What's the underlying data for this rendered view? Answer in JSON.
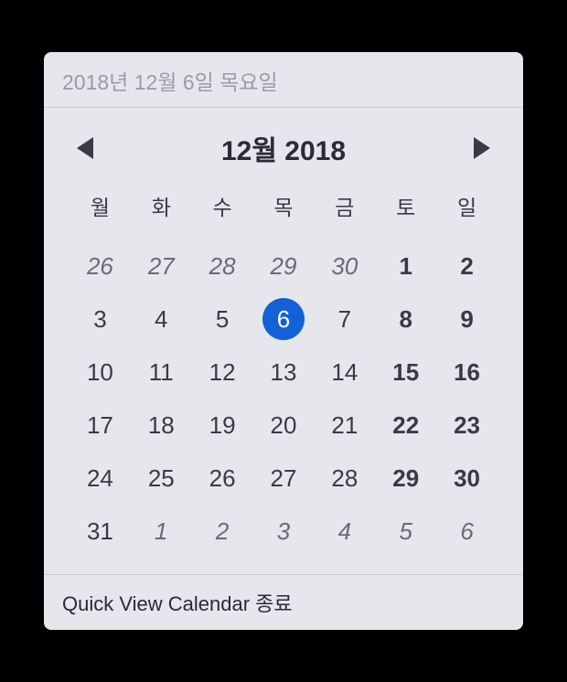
{
  "header": {
    "full_date": "2018년 12월 6일 목요일"
  },
  "nav": {
    "month_title": "12월 2018"
  },
  "weekdays": [
    "월",
    "화",
    "수",
    "목",
    "금",
    "토",
    "일"
  ],
  "calendar": {
    "today": 6,
    "weeks": [
      [
        {
          "day": "26",
          "type": "other"
        },
        {
          "day": "27",
          "type": "other"
        },
        {
          "day": "28",
          "type": "other"
        },
        {
          "day": "29",
          "type": "other"
        },
        {
          "day": "30",
          "type": "other"
        },
        {
          "day": "1",
          "type": "weekend"
        },
        {
          "day": "2",
          "type": "weekend"
        }
      ],
      [
        {
          "day": "3",
          "type": "current"
        },
        {
          "day": "4",
          "type": "current"
        },
        {
          "day": "5",
          "type": "current"
        },
        {
          "day": "6",
          "type": "today"
        },
        {
          "day": "7",
          "type": "current"
        },
        {
          "day": "8",
          "type": "weekend"
        },
        {
          "day": "9",
          "type": "weekend"
        }
      ],
      [
        {
          "day": "10",
          "type": "current"
        },
        {
          "day": "11",
          "type": "current"
        },
        {
          "day": "12",
          "type": "current"
        },
        {
          "day": "13",
          "type": "current"
        },
        {
          "day": "14",
          "type": "current"
        },
        {
          "day": "15",
          "type": "weekend"
        },
        {
          "day": "16",
          "type": "weekend"
        }
      ],
      [
        {
          "day": "17",
          "type": "current"
        },
        {
          "day": "18",
          "type": "current"
        },
        {
          "day": "19",
          "type": "current"
        },
        {
          "day": "20",
          "type": "current"
        },
        {
          "day": "21",
          "type": "current"
        },
        {
          "day": "22",
          "type": "weekend"
        },
        {
          "day": "23",
          "type": "weekend"
        }
      ],
      [
        {
          "day": "24",
          "type": "current"
        },
        {
          "day": "25",
          "type": "current"
        },
        {
          "day": "26",
          "type": "current"
        },
        {
          "day": "27",
          "type": "current"
        },
        {
          "day": "28",
          "type": "current"
        },
        {
          "day": "29",
          "type": "weekend"
        },
        {
          "day": "30",
          "type": "weekend"
        }
      ],
      [
        {
          "day": "31",
          "type": "current"
        },
        {
          "day": "1",
          "type": "other"
        },
        {
          "day": "2",
          "type": "other"
        },
        {
          "day": "3",
          "type": "other"
        },
        {
          "day": "4",
          "type": "other"
        },
        {
          "day": "5",
          "type": "other"
        },
        {
          "day": "6",
          "type": "other"
        }
      ]
    ]
  },
  "footer": {
    "quit_label": "Quick View Calendar 종료"
  }
}
